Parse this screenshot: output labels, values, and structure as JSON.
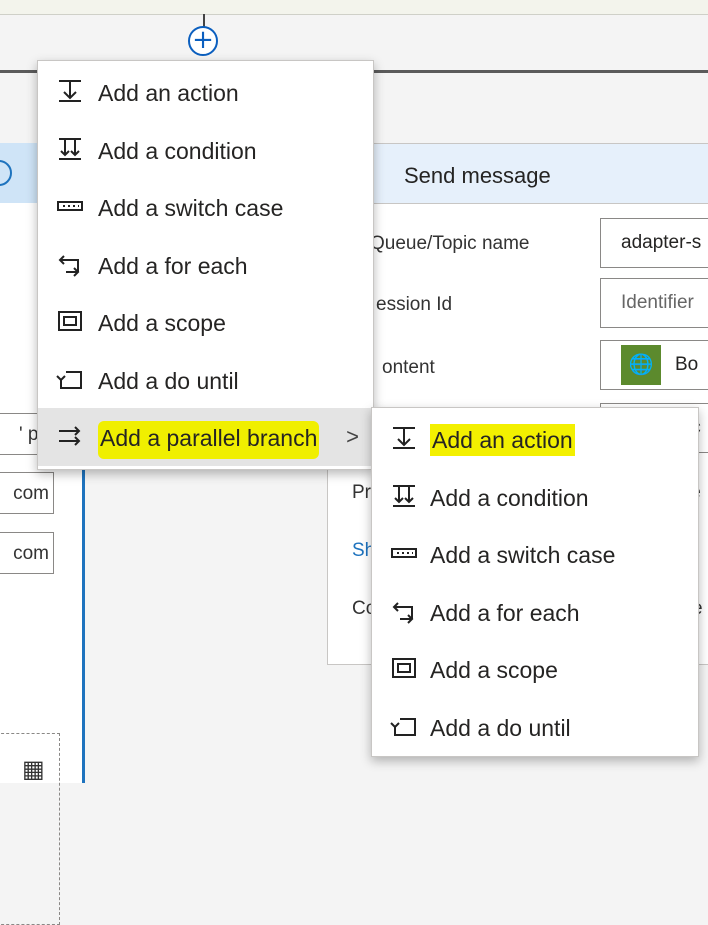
{
  "menu": {
    "items": [
      {
        "label": "Add an action",
        "icon": "add-action-icon"
      },
      {
        "label": "Add a condition",
        "icon": "add-condition-icon"
      },
      {
        "label": "Add a switch case",
        "icon": "switch-case-icon"
      },
      {
        "label": "Add a for each",
        "icon": "for-each-icon"
      },
      {
        "label": "Add a scope",
        "icon": "scope-icon"
      },
      {
        "label": "Add a do until",
        "icon": "do-until-icon"
      },
      {
        "label": "Add a parallel branch",
        "icon": "parallel-branch-icon",
        "chevron": ">"
      }
    ]
  },
  "submenu": {
    "items": [
      {
        "label": "Add an action",
        "icon": "add-action-icon"
      },
      {
        "label": "Add a condition",
        "icon": "add-condition-icon"
      },
      {
        "label": "Add a switch case",
        "icon": "switch-case-icon"
      },
      {
        "label": "Add a for each",
        "icon": "for-each-icon"
      },
      {
        "label": "Add a scope",
        "icon": "scope-icon"
      },
      {
        "label": "Add a do until",
        "icon": "do-until-icon"
      }
    ]
  },
  "send_message": {
    "title": "Send message",
    "fields": [
      {
        "label": "Queue/Topic name",
        "value": "adapter-s"
      },
      {
        "label": "ession Id",
        "placeholder": "Identifier"
      },
      {
        "label": "ontent",
        "value": "Bo"
      }
    ],
    "partial_rows": [
      "Pr",
      "Sh",
      "Co"
    ],
    "partial_right": [
      "ic",
      "ie",
      "e"
    ]
  },
  "left_card": {
    "fields": [
      "' pe",
      "com",
      "com"
    ]
  },
  "colors": {
    "accent": "#1e73be",
    "highlight": "#f3f000",
    "header_bg": "#e6f0fb"
  }
}
